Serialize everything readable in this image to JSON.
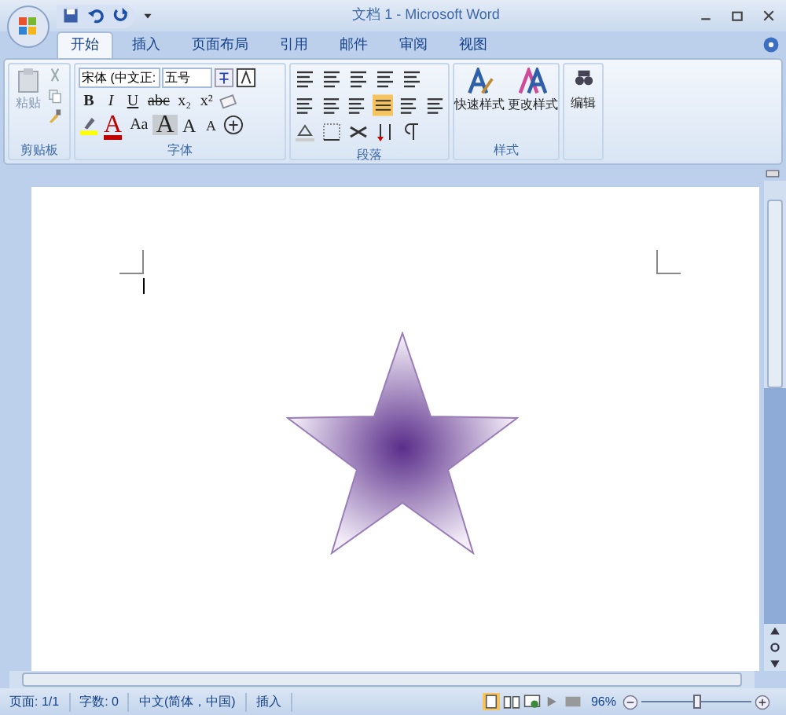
{
  "window": {
    "title": "文档 1 - Microsoft Word"
  },
  "tabs": [
    {
      "label": "开始",
      "selected": true
    },
    {
      "label": "插入",
      "selected": false
    },
    {
      "label": "页面布局",
      "selected": false
    },
    {
      "label": "引用",
      "selected": false
    },
    {
      "label": "邮件",
      "selected": false
    },
    {
      "label": "审阅",
      "selected": false
    },
    {
      "label": "视图",
      "selected": false
    }
  ],
  "ribbon": {
    "clipboard": {
      "paste": "粘贴",
      "label": "剪贴板"
    },
    "font": {
      "name": "宋体 (中文正:",
      "size": "五号",
      "row1": [
        "B",
        "I",
        "U",
        "abc",
        "x₂",
        "x²"
      ],
      "row2": [
        "A",
        "Aa",
        "A",
        "A",
        "A"
      ],
      "label": "字体"
    },
    "paragraph": {
      "label": "段落"
    },
    "styles": {
      "buttons": [
        "快速样式",
        "更改样式"
      ],
      "label": "样式"
    },
    "editing": {
      "button": "编辑"
    }
  },
  "status_bar": {
    "items": [
      "页面: 1/1",
      "字数: 0",
      "中文(简体，中国)",
      "插入"
    ],
    "zoom": "96%",
    "zoom_slider": {
      "level": 0.5
    }
  }
}
